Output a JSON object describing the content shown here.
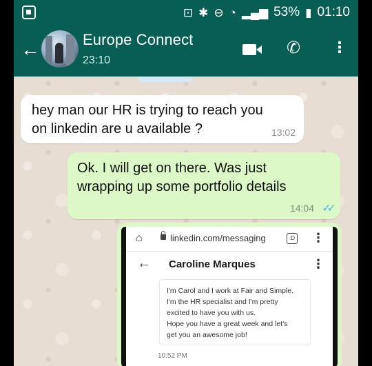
{
  "status_bar": {
    "battery": "53%",
    "time": "01:10"
  },
  "header": {
    "title": "Europe Connect",
    "subtitle": "23:10"
  },
  "messages": [
    {
      "direction": "incoming",
      "text_lines": [
        "hey man our HR is trying to reach you",
        "on linkedin are u available ?"
      ],
      "time": "13:02"
    },
    {
      "direction": "outgoing",
      "text_lines": [
        "Ok. I will get on there. Was just",
        "wrapping up some portfolio details"
      ],
      "time": "14:04",
      "ticks": "✓✓"
    }
  ],
  "attachment": {
    "url": "linkedin.com/messaging",
    "tabs_count": ":D",
    "contact_name": "Caroline Marques",
    "message_lines": [
      "I'm Carol and I work at Fair and Simple.",
      "I'm the HR specialist and I'm pretty",
      "excited to have you with us.",
      "Hope you have a great week and let's",
      "get you an awesome job!"
    ],
    "message_time": "10:52 PM"
  },
  "colors": {
    "header_bg": "#075e54",
    "incoming_bubble": "#ffffff",
    "outgoing_bubble": "#dcf8c6",
    "read_ticks": "#4fb6ec"
  }
}
